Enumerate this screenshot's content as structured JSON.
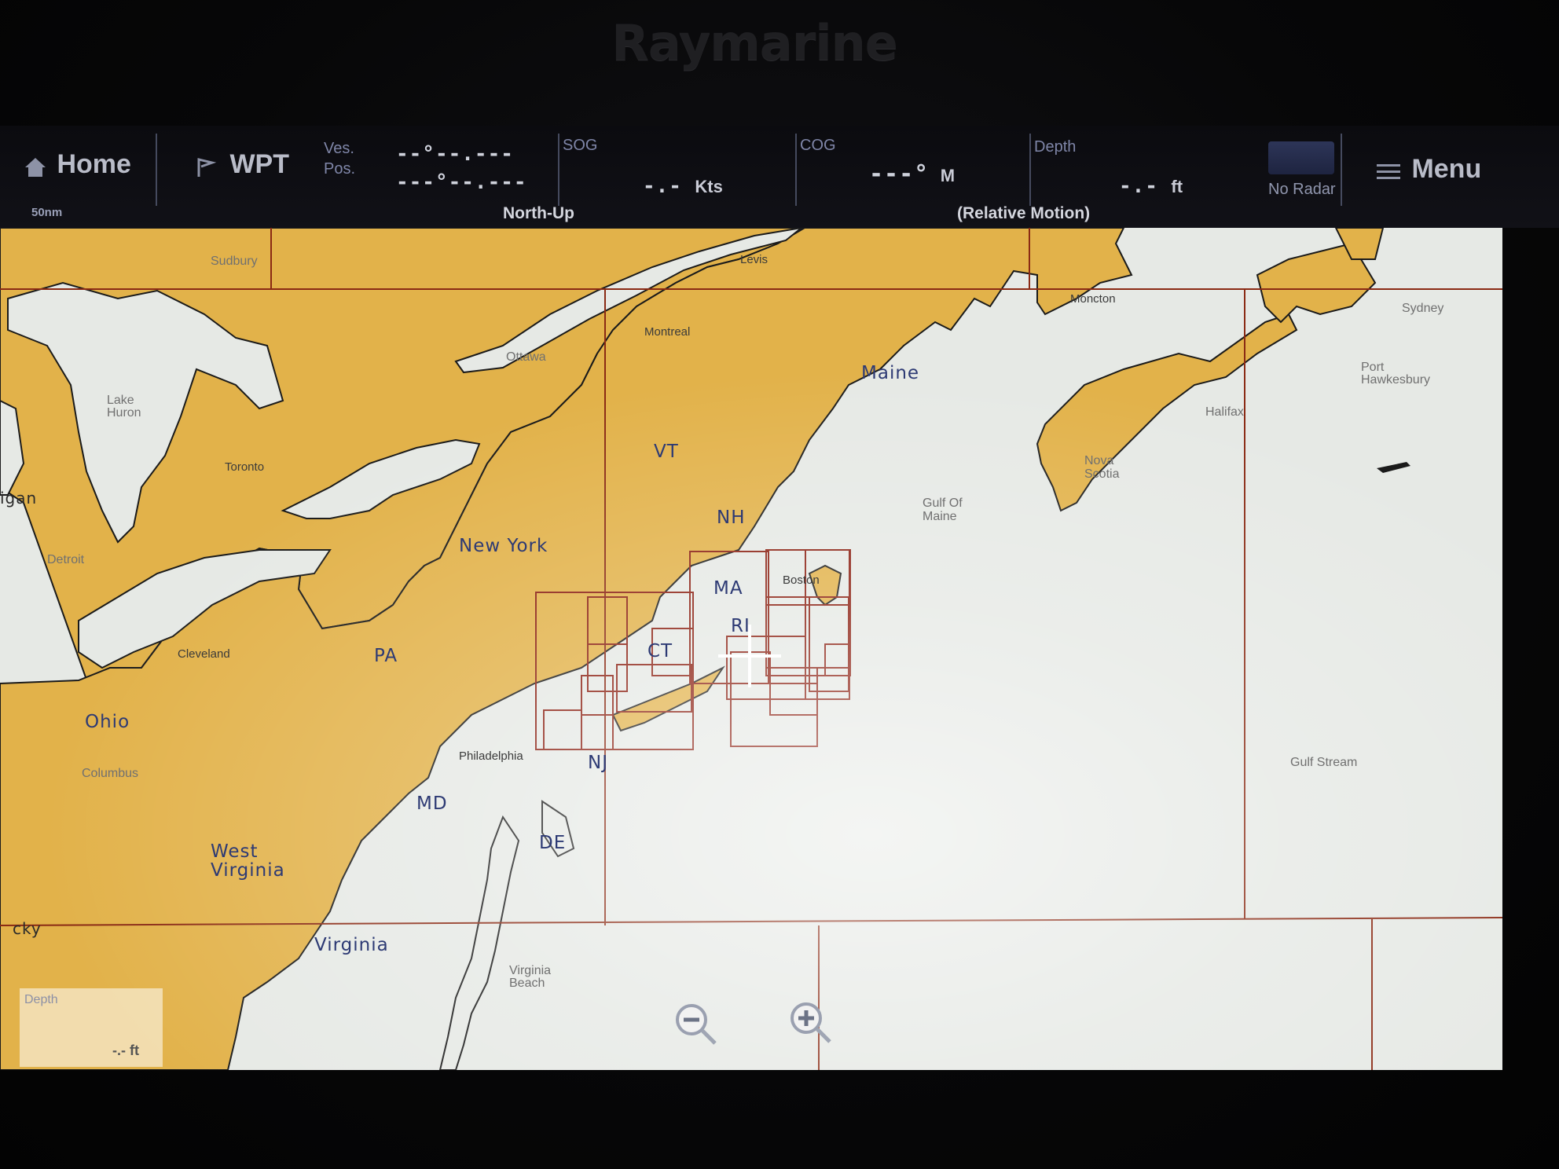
{
  "brand": "Raymarine",
  "topbar": {
    "home_label": "Home",
    "wpt_label": "WPT",
    "vespos_label_1": "Ves.",
    "vespos_label_2": "Pos.",
    "lat_value": "--°--.---",
    "lon_value": "---°--.---",
    "sog_label": "SOG",
    "sog_value": "-.-",
    "sog_unit": "Kts",
    "cog_label": "COG",
    "cog_value": "---°",
    "cog_unit": "M",
    "depth_label": "Depth",
    "depth_value": "-.-",
    "depth_unit": "ft",
    "radar_label": "No Radar",
    "menu_label": "Menu",
    "orientation": "North-Up",
    "motion_mode": "(Relative Motion)",
    "scale_label": "50nm"
  },
  "map": {
    "states": [
      "Maine",
      "VT",
      "NH",
      "New York",
      "MA",
      "RI",
      "CT",
      "PA",
      "NJ",
      "Ohio",
      "MD",
      "DE",
      "West Virginia",
      "Virginia"
    ],
    "cities": [
      "Sudbury",
      "Levis",
      "Moncton",
      "Montreal",
      "Ottawa",
      "Toronto",
      "Detroit",
      "Cleveland",
      "Columbus",
      "Philadelphia",
      "Boston",
      "Halifax",
      "Port Hawkesbury",
      "Sydney",
      "Virginia Beach"
    ],
    "water_labels": [
      "Lake Huron",
      "Gulf Of Maine",
      "Gulf Stream",
      "Nova Scotia"
    ],
    "edge_labels": [
      "igan",
      "cky"
    ],
    "depth_box_label": "Depth",
    "depth_box_value": "-.- ft"
  },
  "colors": {
    "land": "#e2b24a",
    "water": "#e8eae6",
    "coast": "#1a1a1a",
    "chart_outline": "#8a1e10",
    "bar_bg": "#0c0c10"
  }
}
